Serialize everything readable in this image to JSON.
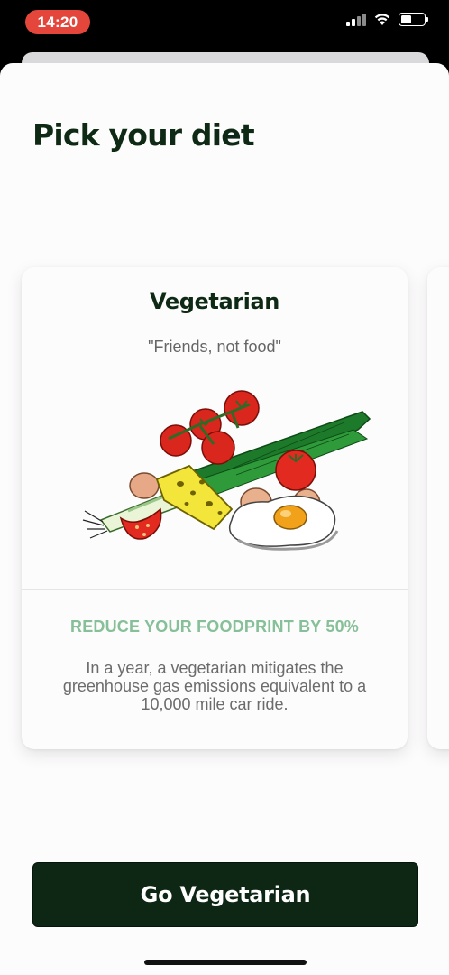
{
  "status_bar": {
    "time": "14:20",
    "icons": [
      "cellular-signal-icon",
      "wifi-icon",
      "battery-icon"
    ],
    "battery_level": 0.45
  },
  "page": {
    "title": "Pick your diet"
  },
  "diet_card": {
    "title": "Vegetarian",
    "subtitle": "\"Friends, not food\"",
    "illustration": "vegetables-eggs-cheese-illustration",
    "impact_headline": "REDUCE YOUR FOODPRINT BY 50%",
    "impact_body": "In a year, a vegetarian mitigates the greenhouse gas emissions equivalent to a 10,000 mile car ride."
  },
  "cta": {
    "label": "Go Vegetarian"
  },
  "colors": {
    "accent_dark_green": "#0d2714",
    "impact_green": "#86bf98",
    "time_pill_red": "#e5463c"
  }
}
